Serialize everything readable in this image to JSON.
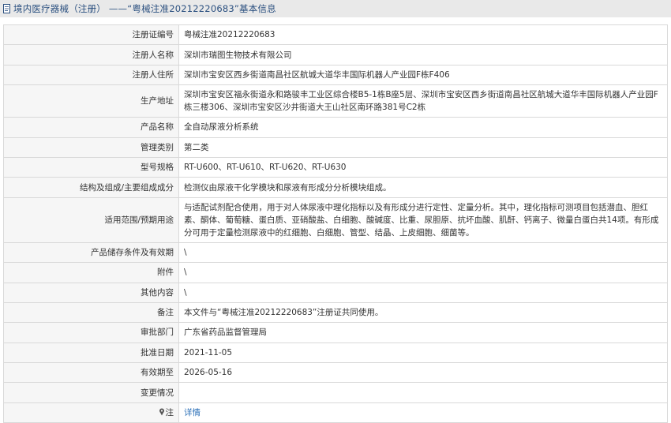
{
  "header": {
    "title": "境内医疗器械（注册） ——“粤械注准20212220683”基本信息"
  },
  "rows": [
    {
      "label": "注册证编号",
      "value": "粤械注准20212220683"
    },
    {
      "label": "注册人名称",
      "value": "深圳市瑞图生物技术有限公司"
    },
    {
      "label": "注册人住所",
      "value": "深圳市宝安区西乡街道南昌社区航城大道华丰国际机器人产业园F栋F406"
    },
    {
      "label": "生产地址",
      "value": "深圳市宝安区福永街道永和路骏丰工业区综合楼B5-1栋B座5层、深圳市宝安区西乡街道南昌社区航城大道华丰国际机器人产业园F栋三楼306、深圳市宝安区沙井街道大王山社区南环路381号C2栋"
    },
    {
      "label": "产品名称",
      "value": "全自动尿液分析系统"
    },
    {
      "label": "管理类别",
      "value": "第二类"
    },
    {
      "label": "型号规格",
      "value": "RT-U600、RT-U610、RT-U620、RT-U630"
    },
    {
      "label": "结构及组成/主要组成成分",
      "value": "检测仪由尿液干化学模块和尿液有形成分分析模块组成。"
    },
    {
      "label": "适用范围/预期用途",
      "value": "与适配试剂配合使用，用于对人体尿液中理化指标以及有形成分进行定性、定量分析。其中，理化指标可测项目包括潜血、胆红素、酮体、葡萄糖、蛋白质、亚硝酸盐、白细胞、酸碱度、比重、尿胆原、抗坏血酸、肌酐、钙离子、微量白蛋白共14项。有形成分可用于定量检测尿液中的红细胞、白细胞、管型、结晶、上皮细胞、细菌等。"
    },
    {
      "label": "产品储存条件及有效期",
      "value": "\\"
    },
    {
      "label": "附件",
      "value": "\\"
    },
    {
      "label": "其他内容",
      "value": "\\"
    },
    {
      "label": "备注",
      "value": "本文件与“粤械注准20212220683”注册证共同使用。"
    },
    {
      "label": "审批部门",
      "value": "广东省药品监督管理局"
    },
    {
      "label": "批准日期",
      "value": "2021-11-05"
    },
    {
      "label": "有效期至",
      "value": "2026-05-16"
    },
    {
      "label": "变更情况",
      "value": ""
    }
  ],
  "footer_row": {
    "label": "注",
    "link_text": "详情",
    "icon": "pin-icon"
  }
}
